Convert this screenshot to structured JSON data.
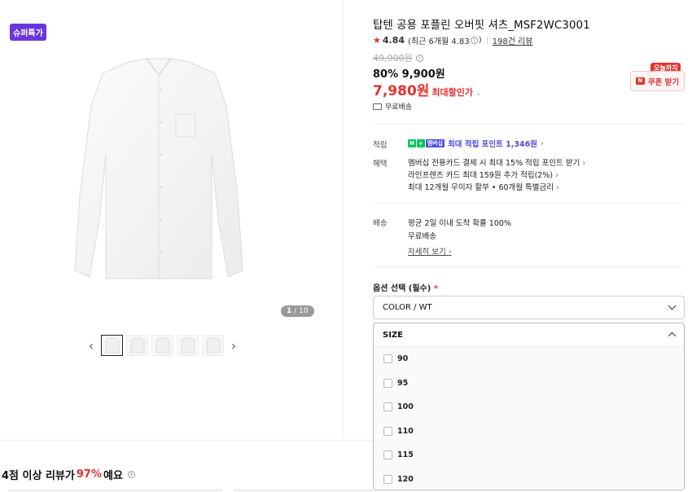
{
  "badge": "슈퍼특가",
  "image_counter": {
    "current": "1",
    "total": "/ 10"
  },
  "product": {
    "title": "탑텐 공용 포플린 오버핏 셔츠_MSF2WC3001",
    "rating": "4.84",
    "rating_recent": "(최근 6개월 4.83",
    "rating_recent_close": ")",
    "review_count": "198건 리뷰",
    "original_price": "49,900원",
    "sale_discount": "80%",
    "sale_price": "9,900원",
    "max_price": "7,980원",
    "max_label": "최대할인가",
    "free_shipping": "무료배송"
  },
  "coupon": {
    "tag": "오늘까지",
    "label": "쿠폰 받기"
  },
  "points": {
    "label": "적립",
    "chip": [
      "N",
      "+",
      "멤버십"
    ],
    "text": "최대 적립 포인트 1,346원"
  },
  "benefits": {
    "label": "혜택",
    "lines": [
      "멤버십 전용카드 결제 시 최대 15% 적립 포인트 받기",
      "라인프렌즈 카드 최대 159원 추가 적립(2%)",
      "최대 12개월 무이자 할부 • 60개월 특별금리"
    ]
  },
  "shipping": {
    "label": "배송",
    "lines": [
      "평균 2일 이내 도착 확률 100%",
      "무료배송"
    ],
    "detail_link": "자세히 보기"
  },
  "options": {
    "title": "옵션 선택 (필수)",
    "required_mark": "*",
    "color_select": "COLOR / WT",
    "size_label": "SIZE",
    "sizes": [
      "90",
      "95",
      "100",
      "110",
      "115",
      "120"
    ]
  },
  "review_summary": {
    "prefix": "4점 이상 리뷰가 ",
    "percent": "97%",
    "suffix": "예요"
  },
  "colors": {
    "accent_red": "#e6322d",
    "badge_purple": "#6b35e0",
    "points_blue": "#4b4be6"
  }
}
